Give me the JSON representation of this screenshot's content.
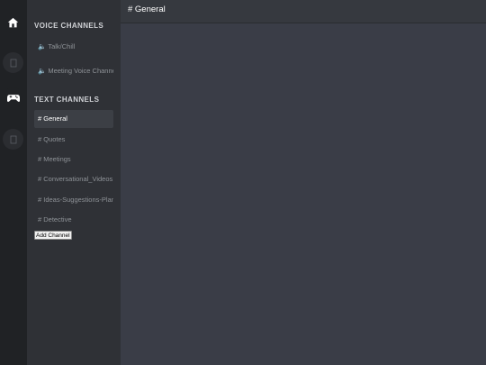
{
  "servers": [
    {
      "icon": "home-icon",
      "active": true
    },
    {
      "icon": "placeholder-icon",
      "active": false
    },
    {
      "icon": "gamepad-icon",
      "active": true
    },
    {
      "icon": "placeholder-icon",
      "active": false
    }
  ],
  "voice_category": "VOICE CHANNELS",
  "voice_channels": [
    {
      "speaker": "🔈",
      "label": "Talk/Chill"
    },
    {
      "speaker": "🔈",
      "label": "Meeting Voice Channel"
    }
  ],
  "text_category": "TEXT CHANNELS",
  "text_channels": [
    {
      "label": "# General",
      "active": true
    },
    {
      "label": "# Quotes",
      "active": false
    },
    {
      "label": "# Meetings",
      "active": false
    },
    {
      "label": "# Conversational_Videos",
      "active": false
    },
    {
      "label": "# Ideas-Suggestions-Plans",
      "active": false
    },
    {
      "label": "# Detective",
      "active": false
    }
  ],
  "add_channel_label": "Add Channel",
  "header": {
    "title": "# General"
  },
  "colors": {
    "server_bar": "#202225",
    "channel_sidebar": "#2f3136",
    "main_bg": "#3a3d47",
    "active_channel_bg": "#3c3f45"
  }
}
